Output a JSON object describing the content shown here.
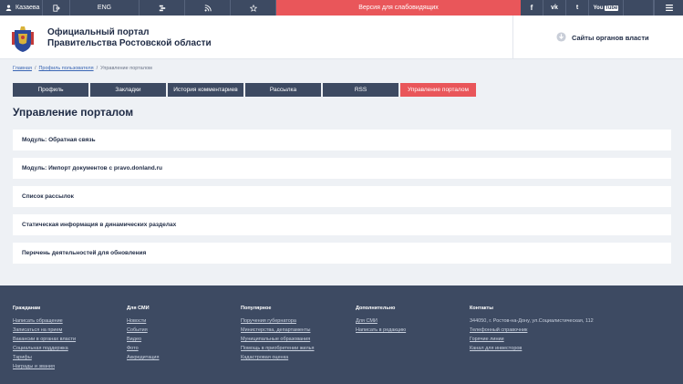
{
  "topbar": {
    "user": "Казаева",
    "lang": "ENG",
    "bvi": "Версия для слабовидящих",
    "youtube_prefix": "You",
    "youtube_suffix": "Tube"
  },
  "header": {
    "title_line1": "Официальный портал",
    "title_line2": "Правительства Ростовской области",
    "gov_sites": "Сайты органов власти"
  },
  "breadcrumb": {
    "home": "Главная",
    "profile": "Профиль пользователя",
    "current": "Управление порталом",
    "sep": "/"
  },
  "tabs": [
    "Профиль",
    "Закладки",
    "История комментариев",
    "Рассылка",
    "RSS",
    "Управление порталом"
  ],
  "page_title": "Управление порталом",
  "items": [
    "Модуль: Обратная связь",
    "Модуль: Импорт документов с pravo.donland.ru",
    "Список рассылок",
    "Статическая информация в динамических разделах",
    "Перечень деятельностей для обновления"
  ],
  "footer": {
    "col1": {
      "title": "Гражданам",
      "links": [
        "Написать обращение",
        "Записаться на прием",
        "Вакансии в органах власти",
        "Социальная поддержка",
        "Тарифы",
        "Награды и звания"
      ]
    },
    "col2": {
      "title": "Для СМИ",
      "links": [
        "Новости",
        "События",
        "Видео",
        "Фото",
        "Аккредитация"
      ]
    },
    "col3": {
      "title": "Популярное",
      "links": [
        "Поручения губернатора",
        "Министерства, департаменты",
        "Муниципальные образования",
        "Помощь в приобретении жилья",
        "Кадастровая оценка"
      ]
    },
    "col4": {
      "title": "Дополнительно",
      "links": [
        "Для СМИ",
        "Написать в редакцию"
      ]
    },
    "col5": {
      "title": "Контакты",
      "address": "344050, г. Ростов-на-Дону, ул.Социалистическая, 112",
      "links": [
        "Телефонный справочник",
        "Горячие линии",
        "Канал для инвесторов"
      ]
    }
  },
  "colors": {
    "topbar": "#3d4a62",
    "accent": "#e9565a",
    "background": "#eef1f5"
  }
}
